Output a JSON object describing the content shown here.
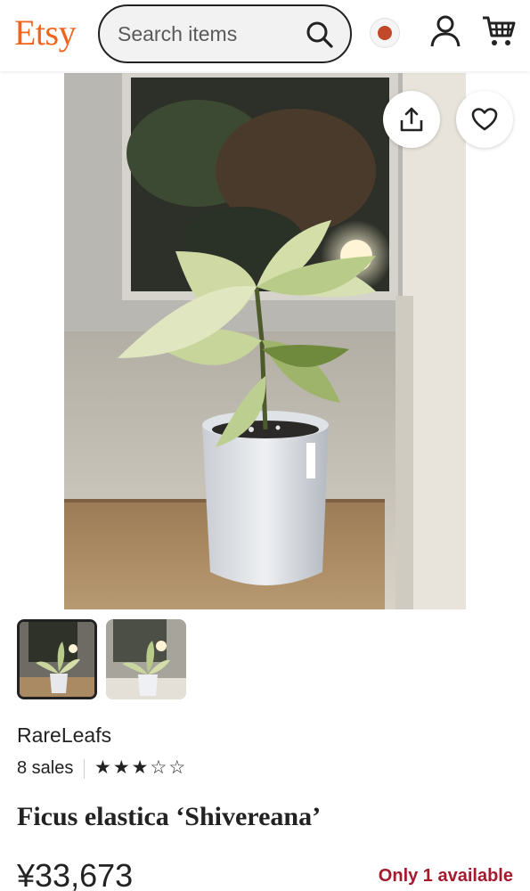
{
  "header": {
    "logo_text": "Etsy",
    "search_placeholder": "Search items",
    "locale_dot_color": "#C1492A",
    "icons": [
      "search-icon",
      "locale-icon",
      "user-icon",
      "cart-icon"
    ]
  },
  "product_image": {
    "actions": [
      "share-icon",
      "heart-icon"
    ]
  },
  "gallery": {
    "thumbnail_count": 2,
    "selected_index": 0
  },
  "shop": {
    "name": "RareLeafs",
    "sales": "8 sales",
    "rating": 3,
    "max_rating": 5
  },
  "listing": {
    "title": "Ficus elastica ‘Shivereana’",
    "price": "¥33,673",
    "availability": "Only 1 available"
  },
  "colors": {
    "brand": "#F1641E",
    "availability": "#A61A2E",
    "text": "#222222"
  }
}
